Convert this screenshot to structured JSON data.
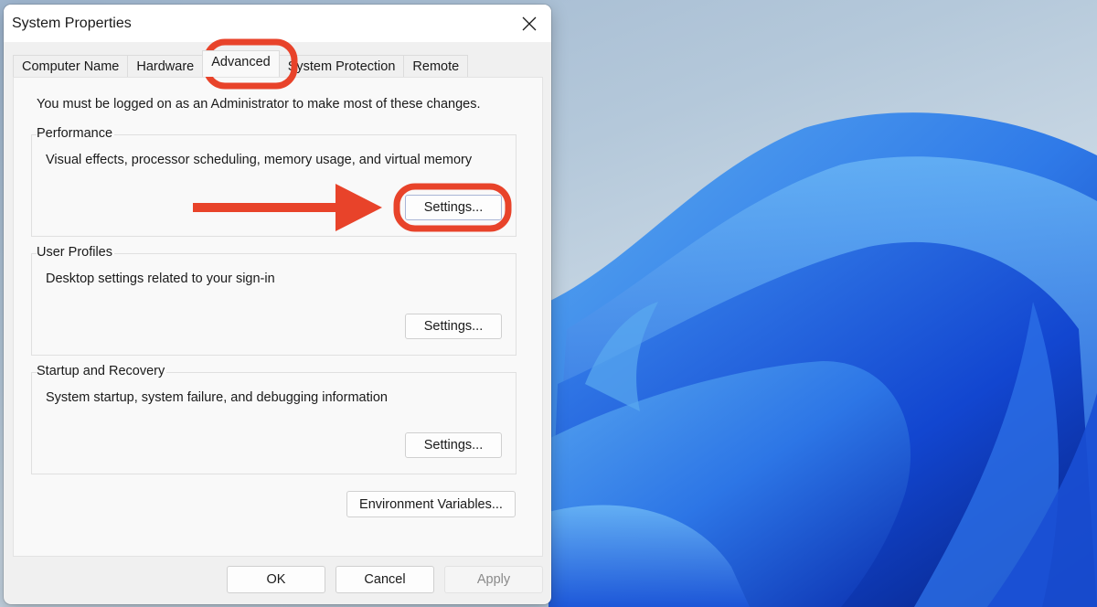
{
  "dialog": {
    "title": "System Properties",
    "close_icon": "close-icon"
  },
  "tabs": [
    {
      "label": "Computer Name",
      "active": false
    },
    {
      "label": "Hardware",
      "active": false
    },
    {
      "label": "Advanced",
      "active": true
    },
    {
      "label": "System Protection",
      "active": false
    },
    {
      "label": "Remote",
      "active": false
    }
  ],
  "advanced": {
    "admin_note": "You must be logged on as an Administrator to make most of these changes.",
    "performance": {
      "label": "Performance",
      "description": "Visual effects, processor scheduling, memory usage, and virtual memory",
      "button": "Settings..."
    },
    "user_profiles": {
      "label": "User Profiles",
      "description": "Desktop settings related to your sign-in",
      "button": "Settings..."
    },
    "startup_recovery": {
      "label": "Startup and Recovery",
      "description": "System startup, system failure, and debugging information",
      "button": "Settings..."
    },
    "env_button": "Environment Variables..."
  },
  "footer": {
    "ok": "OK",
    "cancel": "Cancel",
    "apply": "Apply"
  },
  "annotations": {
    "color": "#E8432A",
    "highlights": [
      "Advanced tab",
      "Performance Settings button"
    ],
    "arrow_target": "Performance Settings button"
  }
}
